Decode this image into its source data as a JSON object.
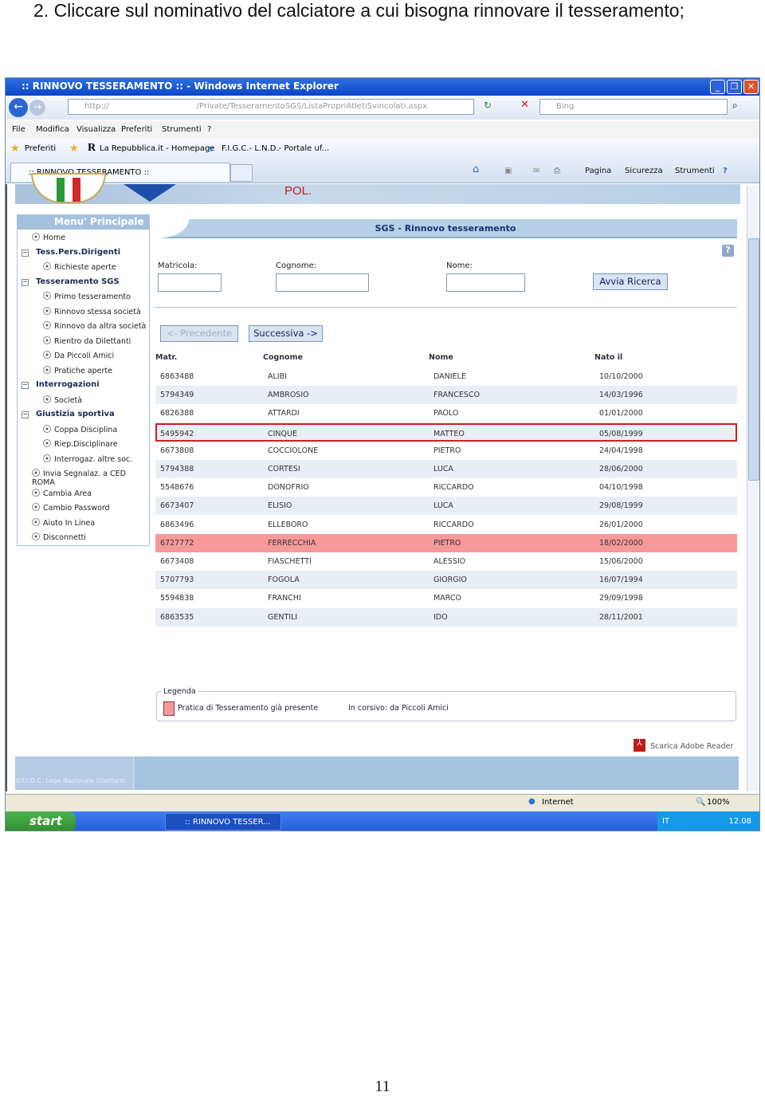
{
  "heading": "2.   Cliccare sul nominativo del calciatore a cui bisogna rinnovare il tesseramento;",
  "browser": {
    "window_title": ":: RINNOVO TESSERAMENTO :: - Windows Internet Explorer",
    "url_prefix": "http://",
    "url_path": "/Private/TesseramentoSGS/ListaPropriAtletiSvincolati.aspx",
    "search_placeholder": "Bing",
    "menu": [
      "File",
      "Modifica",
      "Visualizza",
      "Preferiti",
      "Strumenti",
      "?"
    ],
    "favorites_label": "Preferiti",
    "favorites": [
      "La Repubblica.it - Homepage",
      "F.I.G.C.- L.N.D.- Portale uf..."
    ],
    "tab_title": ":: RINNOVO TESSERAMENTO ::",
    "commands": [
      "Pagina",
      "Sicurezza",
      "Strumenti"
    ],
    "status_zone": "Internet",
    "zoom": "100%"
  },
  "site": {
    "banner_text": "POL.",
    "sidebar": {
      "title": "Menu' Principale",
      "items": [
        {
          "label": "Home",
          "type": "item",
          "level": 0
        },
        {
          "label": "Tess.Pers.Dirigenti",
          "type": "group"
        },
        {
          "label": "Richieste aperte",
          "type": "item",
          "level": 1
        },
        {
          "label": "Tesseramento SGS",
          "type": "group"
        },
        {
          "label": "Primo tesseramento",
          "type": "item",
          "level": 1
        },
        {
          "label": "Rinnovo stessa società",
          "type": "item",
          "level": 1
        },
        {
          "label": "Rinnovo da altra società",
          "type": "item",
          "level": 1
        },
        {
          "label": "Rientro da Dilettanti",
          "type": "item",
          "level": 1
        },
        {
          "label": "Da Piccoli Amici",
          "type": "item",
          "level": 1
        },
        {
          "label": "Pratiche aperte",
          "type": "item",
          "level": 1
        },
        {
          "label": "Interrogazioni",
          "type": "group"
        },
        {
          "label": "Società",
          "type": "item",
          "level": 1
        },
        {
          "label": "Giustizia sportiva",
          "type": "group"
        },
        {
          "label": "Coppa Disciplina",
          "type": "item",
          "level": 1
        },
        {
          "label": "Riep.Disciplinare",
          "type": "item",
          "level": 1
        },
        {
          "label": "Interrogaz. altre soc.",
          "type": "item",
          "level": 1
        },
        {
          "label": "Invia Segnalaz. a CED ROMA",
          "type": "item",
          "level": 0
        },
        {
          "label": "Cambia Area",
          "type": "item",
          "level": 0
        },
        {
          "label": "Cambio Password",
          "type": "item",
          "level": 0
        },
        {
          "label": "Aiuto In Linea",
          "type": "item",
          "level": 0
        },
        {
          "label": "Disconnetti",
          "type": "item",
          "level": 0
        }
      ]
    },
    "panel_title": "SGS - Rinnovo tesseramento",
    "form": {
      "matricola_label": "Matricola:",
      "cognome_label": "Cognome:",
      "nome_label": "Nome:",
      "matricola_value": "",
      "cognome_value": "",
      "nome_value": "",
      "search_button": "Avvia Ricerca"
    },
    "pager": {
      "prev": "<- Precedente",
      "next": "Successiva ->"
    },
    "table": {
      "headers": [
        "Matr.",
        "Cognome",
        "Nome",
        "Nato il"
      ],
      "rows": [
        {
          "cells": [
            "6863488",
            "ALIBI",
            "DANIELE",
            "10/10/2000"
          ],
          "state": ""
        },
        {
          "cells": [
            "5794349",
            "AMBROSIO",
            "FRANCESCO",
            "14/03/1996"
          ],
          "state": ""
        },
        {
          "cells": [
            "6826388",
            "ATTARDI",
            "PAOLO",
            "01/01/2000"
          ],
          "state": ""
        },
        {
          "cells": [
            "5495942",
            "CINQUE",
            "MATTEO",
            "05/08/1999"
          ],
          "state": "selected"
        },
        {
          "cells": [
            "6673808",
            "COCCIOLONE",
            "PIETRO",
            "24/04/1998"
          ],
          "state": ""
        },
        {
          "cells": [
            "5794388",
            "CORTESI",
            "LUCA",
            "28/06/2000"
          ],
          "state": ""
        },
        {
          "cells": [
            "5548676",
            "DONOFRIO",
            "RICCARDO",
            "04/10/1998"
          ],
          "state": ""
        },
        {
          "cells": [
            "6673407",
            "ELISIO",
            "LUCA",
            "29/08/1999"
          ],
          "state": ""
        },
        {
          "cells": [
            "6863496",
            "ELLEBORO",
            "RICCARDO",
            "26/01/2000"
          ],
          "state": ""
        },
        {
          "cells": [
            "6727772",
            "FERRECCHIA",
            "PIETRO",
            "18/02/2000"
          ],
          "state": "pratica-presente"
        },
        {
          "cells": [
            "6673408",
            "FIASCHETTI",
            "ALESSIO",
            "15/06/2000"
          ],
          "state": ""
        },
        {
          "cells": [
            "5707793",
            "FOGOLA",
            "GIORGIO",
            "16/07/1994"
          ],
          "state": ""
        },
        {
          "cells": [
            "5594838",
            "FRANCHI",
            "MARCO",
            "29/09/1998"
          ],
          "state": ""
        },
        {
          "cells": [
            "6863535",
            "GENTILI",
            "IDO",
            "28/11/2001"
          ],
          "state": ""
        }
      ]
    },
    "legend": {
      "title": "Legenda",
      "pink_label": "Pratica di Tesseramento già presente",
      "italic_label": "In corsivo: da Piccoli Amici"
    },
    "adobe_link": "Scarica Adobe Reader",
    "footer": "©F.I.G.C. Lega Nazionale Dilettanti"
  },
  "taskbar": {
    "start": "start",
    "task": ":: RINNOVO TESSER...",
    "lang": "IT",
    "clock": "12.08"
  },
  "page_number": "11",
  "colors": {
    "pink_row": "#f7999b",
    "selection_border": "#c8202a",
    "title_bar": "#0a46c8",
    "panel_blue": "#b7cfe6"
  }
}
